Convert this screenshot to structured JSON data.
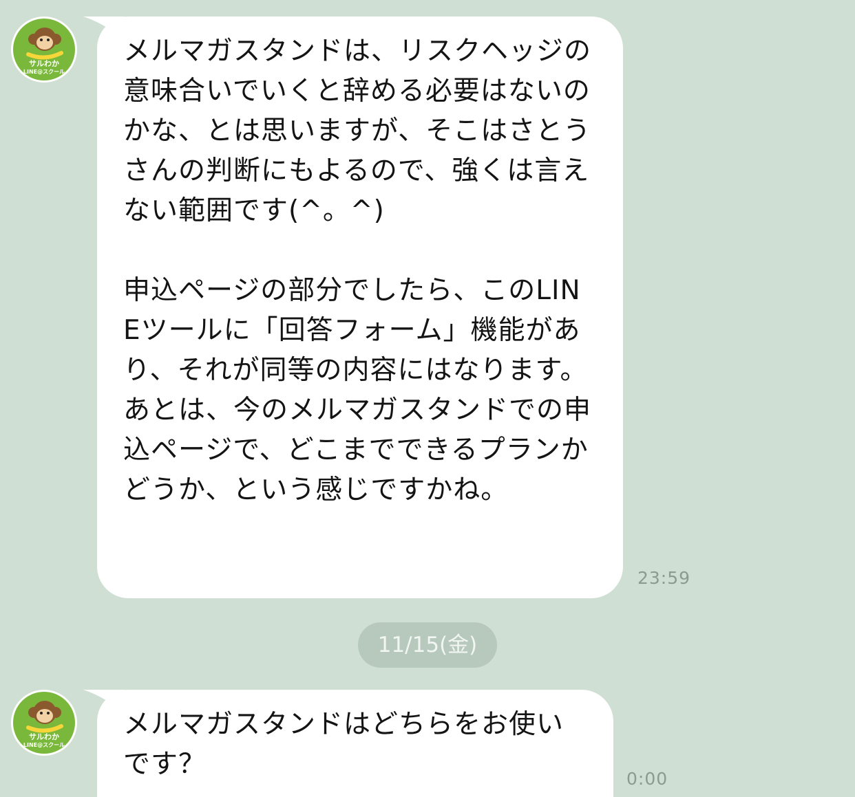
{
  "contact": {
    "avatar_line1": "サルわか",
    "avatar_line2": "LINE@スクール"
  },
  "messages": [
    {
      "text": "メルマガスタンドは、リスクヘッジの意味合いでいくと辞める必要はないのかな、とは思いますが、そこはさとうさんの判断にもよるので、強くは言えない範囲です(^。^)\n\n申込ページの部分でしたら、このLINEツールに「回答フォーム」機能があり、それが同等の内容にはなります。あとは、今のメルマガスタンドでの申込ページで、どこまでできるプランかどうか、という感じですかね。",
      "time": "23:59"
    },
    {
      "text": "メルマガスタンドはどちらをお使いです？",
      "time": "0:00"
    }
  ],
  "date_separator": "11/15(金)",
  "colors": {
    "background": "#cfdfd3",
    "bubble": "#ffffff",
    "avatar": "#7ab83c",
    "date_pill": "#b7c8bd",
    "timestamp": "#8c9a91"
  },
  "icons": [
    "monkey-avatar-icon",
    "bubble-tail-icon"
  ]
}
